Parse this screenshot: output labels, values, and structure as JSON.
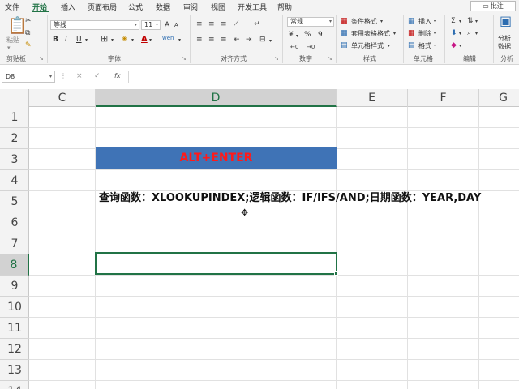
{
  "menu": {
    "items": [
      "文件",
      "开始",
      "插入",
      "页面布局",
      "公式",
      "数据",
      "审阅",
      "视图",
      "开发工具",
      "帮助"
    ],
    "active_index": 1,
    "comment_label": "批注"
  },
  "ribbon": {
    "clipboard": {
      "paste_label": "粘贴",
      "group_label": "剪贴板"
    },
    "font": {
      "font_name": "等线",
      "font_size": "11",
      "bold": "B",
      "italic": "I",
      "underline": "U",
      "grow": "A",
      "shrink": "A",
      "font_color_glyph": "A",
      "phonetic": "wén",
      "group_label": "字体"
    },
    "alignment": {
      "group_label": "对齐方式"
    },
    "number": {
      "format": "常规",
      "currency": "¥",
      "percent": "%",
      "comma": "9",
      "group_label": "数字"
    },
    "styles": {
      "conditional": "条件格式",
      "table": "套用表格格式",
      "cell_styles": "单元格样式",
      "group_label": "样式"
    },
    "cells": {
      "insert": "插入",
      "delete": "删除",
      "format": "格式",
      "group_label": "单元格"
    },
    "editing": {
      "group_label": "编辑"
    },
    "analysis": {
      "label_line1": "分析",
      "label_line2": "数据",
      "group_label": "分析"
    }
  },
  "formula_bar": {
    "name_box": "D8",
    "cancel": "×",
    "enter": "✓",
    "fx": "fx",
    "value": ""
  },
  "sheet": {
    "columns": [
      "C",
      "D",
      "E",
      "F",
      "G"
    ],
    "selected_column": "D",
    "rows": [
      "1",
      "2",
      "3",
      "4",
      "5",
      "6",
      "7",
      "8",
      "9",
      "10",
      "11",
      "12",
      "13",
      "14"
    ],
    "selected_row": "8",
    "d3": "ALT+ENTER",
    "d5": "查询函数：XLOOKUPINDEX;逻辑函数：IF/IFS/AND;日期函数：YEAR,DAY"
  },
  "colors": {
    "accent": "#217346",
    "banner_fill": "#3f73b6",
    "banner_text": "#ff1a1a"
  }
}
